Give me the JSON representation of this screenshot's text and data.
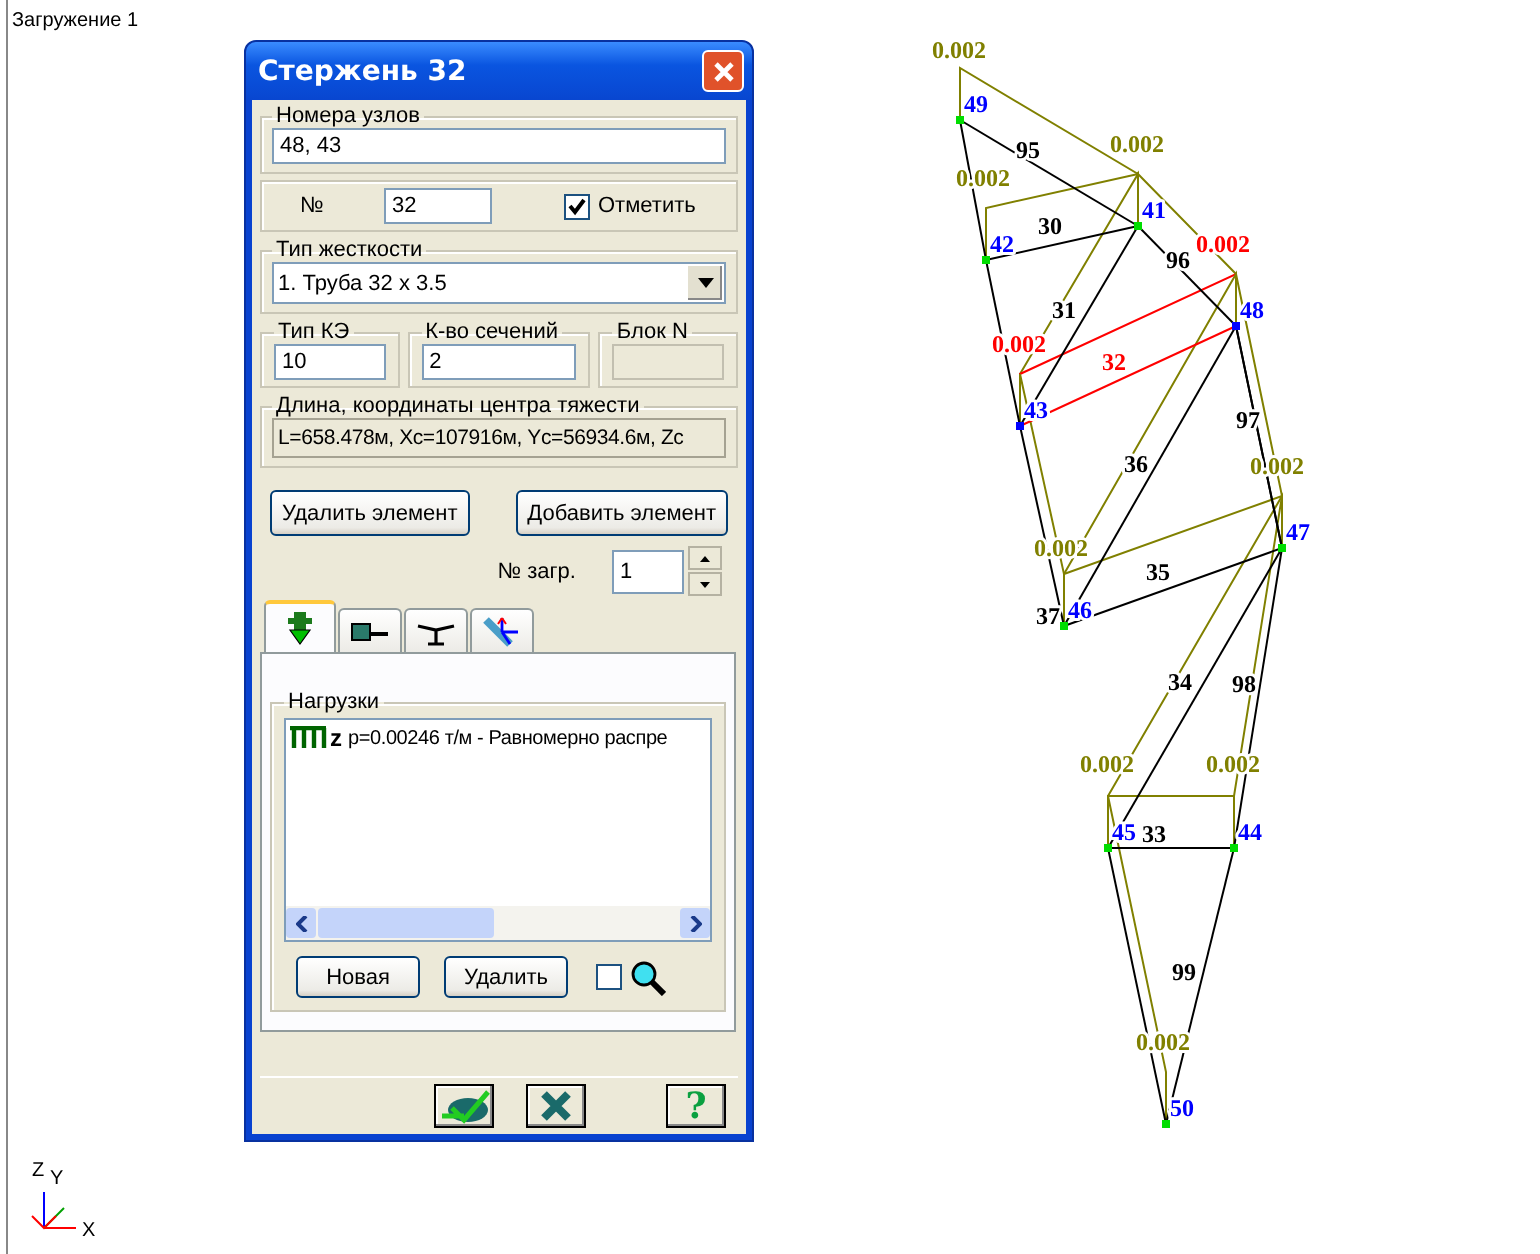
{
  "canvas": {
    "title": "Загружение 1",
    "axes": [
      "Z",
      "Y",
      "X"
    ]
  },
  "dialog": {
    "title": "Стержень 32",
    "nodes_group": {
      "label": "Номера узлов",
      "value": "48, 43"
    },
    "number": {
      "label": "№",
      "value": "32"
    },
    "mark": {
      "label": "Отметить",
      "checked": true
    },
    "stiffness": {
      "label": "Тип жесткости",
      "value": "1. Труба 32 x 3.5"
    },
    "fe_type": {
      "label": "Тип КЭ",
      "value": "10"
    },
    "sections": {
      "label": "К-во сечений",
      "value": "2"
    },
    "block": {
      "label": "Блок N",
      "disabled": true
    },
    "geometry": {
      "label": "Длина, координаты центра тяжести",
      "value": "L=658.478м, Xc=107916м, Yc=56934.6м, Zc"
    },
    "buttons": [
      "Удалить элемент",
      "Добавить элемент"
    ],
    "load_case": {
      "label": "№ загр.",
      "value": "1"
    },
    "tabs": [
      {
        "kind": "load",
        "selected": true
      },
      {
        "kind": "section",
        "selected": false
      },
      {
        "kind": "hinge",
        "selected": false
      },
      {
        "kind": "axes",
        "selected": false
      }
    ],
    "loads": {
      "label": "Нагрузки",
      "items": [
        {
          "symbol": "z",
          "text": "p=0.00246 т/м - Равномерно распре"
        }
      ],
      "buttons": [
        "Новая",
        "Удалить"
      ],
      "filter_checked": false
    },
    "footer": {
      "help": "?"
    }
  },
  "diagram": {
    "nodes": [
      {
        "label": "49",
        "selected": false
      },
      {
        "label": "41",
        "selected": false
      },
      {
        "label": "42",
        "selected": false
      },
      {
        "label": "48",
        "selected": true
      },
      {
        "label": "43",
        "selected": true
      },
      {
        "label": "47",
        "selected": false
      },
      {
        "label": "46",
        "selected": false
      },
      {
        "label": "45",
        "selected": false
      },
      {
        "label": "44",
        "selected": false
      },
      {
        "label": "50",
        "selected": false
      }
    ],
    "elements": [
      {
        "label": "95",
        "selected": false
      },
      {
        "label": "30",
        "selected": false
      },
      {
        "label": "96",
        "selected": false
      },
      {
        "label": "31",
        "selected": false
      },
      {
        "label": "32",
        "selected": true
      },
      {
        "label": "97",
        "selected": false
      },
      {
        "label": "36",
        "selected": false
      },
      {
        "label": "37",
        "selected": false
      },
      {
        "label": "35",
        "selected": false
      },
      {
        "label": "34",
        "selected": false
      },
      {
        "label": "98",
        "selected": false
      },
      {
        "label": "33",
        "selected": false
      },
      {
        "label": "99",
        "selected": false
      }
    ],
    "loads": [
      {
        "label": "0.002",
        "selected": false
      },
      {
        "label": "0.002",
        "selected": false
      },
      {
        "label": "0.002",
        "selected": false
      },
      {
        "label": "0.002",
        "selected": true
      },
      {
        "label": "0.002",
        "selected": true
      },
      {
        "label": "0.002",
        "selected": false
      },
      {
        "label": "0.002",
        "selected": false
      },
      {
        "label": "0.002",
        "selected": false
      },
      {
        "label": "0.002",
        "selected": false
      },
      {
        "label": "0.002",
        "selected": false
      }
    ]
  }
}
